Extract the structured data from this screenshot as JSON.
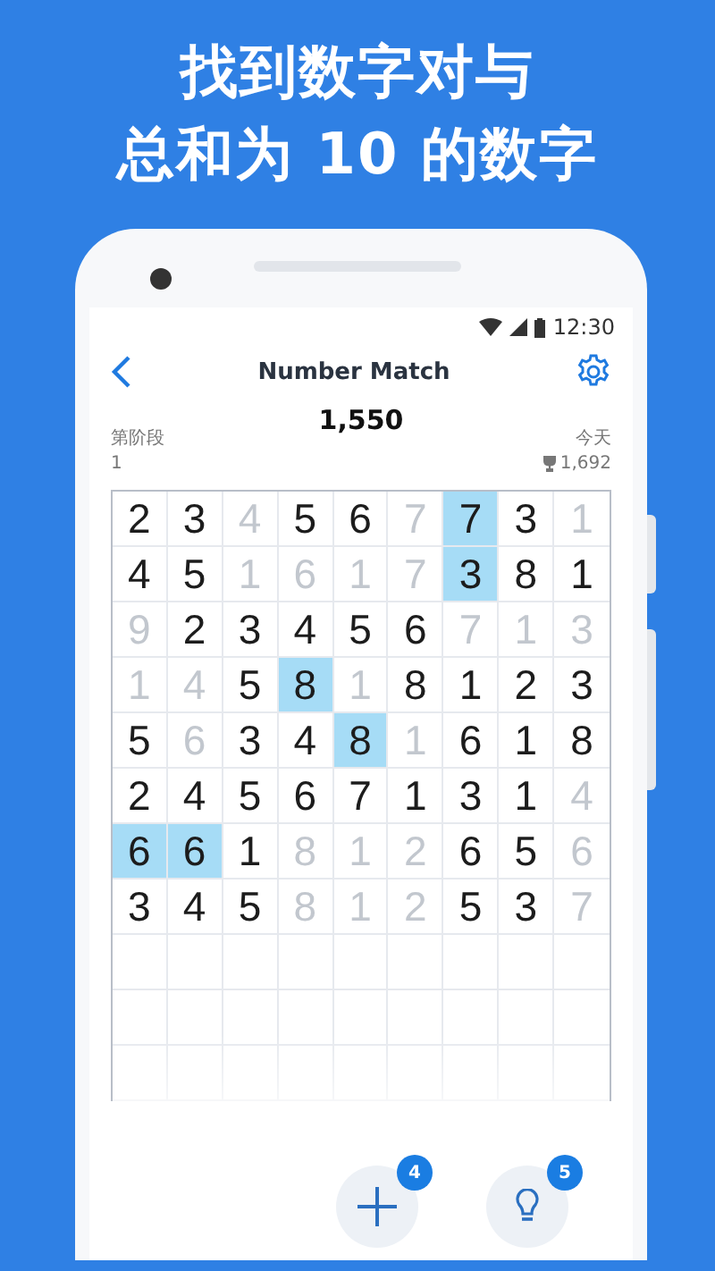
{
  "headline": [
    "找到数字对与",
    "总和为 10 的数字"
  ],
  "status_bar": {
    "time": "12:30"
  },
  "app_bar": {
    "title": "Number Match"
  },
  "score": "1,550",
  "stage": {
    "label": "第阶段",
    "value": "1"
  },
  "best": {
    "label": "今天",
    "value": "1,692"
  },
  "grid": [
    [
      {
        "digit": "2",
        "faded": false,
        "selected": false
      },
      {
        "digit": "3",
        "faded": false,
        "selected": false
      },
      {
        "digit": "4",
        "faded": true,
        "selected": false
      },
      {
        "digit": "5",
        "faded": false,
        "selected": false
      },
      {
        "digit": "6",
        "faded": false,
        "selected": false
      },
      {
        "digit": "7",
        "faded": true,
        "selected": false
      },
      {
        "digit": "7",
        "faded": false,
        "selected": true
      },
      {
        "digit": "3",
        "faded": false,
        "selected": false
      },
      {
        "digit": "1",
        "faded": true,
        "selected": false
      }
    ],
    [
      {
        "digit": "4",
        "faded": false,
        "selected": false
      },
      {
        "digit": "5",
        "faded": false,
        "selected": false
      },
      {
        "digit": "1",
        "faded": true,
        "selected": false
      },
      {
        "digit": "6",
        "faded": true,
        "selected": false
      },
      {
        "digit": "1",
        "faded": true,
        "selected": false
      },
      {
        "digit": "7",
        "faded": true,
        "selected": false
      },
      {
        "digit": "3",
        "faded": false,
        "selected": true
      },
      {
        "digit": "8",
        "faded": false,
        "selected": false
      },
      {
        "digit": "1",
        "faded": false,
        "selected": false
      }
    ],
    [
      {
        "digit": "9",
        "faded": true,
        "selected": false
      },
      {
        "digit": "2",
        "faded": false,
        "selected": false
      },
      {
        "digit": "3",
        "faded": false,
        "selected": false
      },
      {
        "digit": "4",
        "faded": false,
        "selected": false
      },
      {
        "digit": "5",
        "faded": false,
        "selected": false
      },
      {
        "digit": "6",
        "faded": false,
        "selected": false
      },
      {
        "digit": "7",
        "faded": true,
        "selected": false
      },
      {
        "digit": "1",
        "faded": true,
        "selected": false
      },
      {
        "digit": "3",
        "faded": true,
        "selected": false
      }
    ],
    [
      {
        "digit": "1",
        "faded": true,
        "selected": false
      },
      {
        "digit": "4",
        "faded": true,
        "selected": false
      },
      {
        "digit": "5",
        "faded": false,
        "selected": false
      },
      {
        "digit": "8",
        "faded": false,
        "selected": true
      },
      {
        "digit": "1",
        "faded": true,
        "selected": false
      },
      {
        "digit": "8",
        "faded": false,
        "selected": false
      },
      {
        "digit": "1",
        "faded": false,
        "selected": false
      },
      {
        "digit": "2",
        "faded": false,
        "selected": false
      },
      {
        "digit": "3",
        "faded": false,
        "selected": false
      }
    ],
    [
      {
        "digit": "5",
        "faded": false,
        "selected": false
      },
      {
        "digit": "6",
        "faded": true,
        "selected": false
      },
      {
        "digit": "3",
        "faded": false,
        "selected": false
      },
      {
        "digit": "4",
        "faded": false,
        "selected": false
      },
      {
        "digit": "8",
        "faded": false,
        "selected": true
      },
      {
        "digit": "1",
        "faded": true,
        "selected": false
      },
      {
        "digit": "6",
        "faded": false,
        "selected": false
      },
      {
        "digit": "1",
        "faded": false,
        "selected": false
      },
      {
        "digit": "8",
        "faded": false,
        "selected": false
      }
    ],
    [
      {
        "digit": "2",
        "faded": false,
        "selected": false
      },
      {
        "digit": "4",
        "faded": false,
        "selected": false
      },
      {
        "digit": "5",
        "faded": false,
        "selected": false
      },
      {
        "digit": "6",
        "faded": false,
        "selected": false
      },
      {
        "digit": "7",
        "faded": false,
        "selected": false
      },
      {
        "digit": "1",
        "faded": false,
        "selected": false
      },
      {
        "digit": "3",
        "faded": false,
        "selected": false
      },
      {
        "digit": "1",
        "faded": false,
        "selected": false
      },
      {
        "digit": "4",
        "faded": true,
        "selected": false
      }
    ],
    [
      {
        "digit": "6",
        "faded": false,
        "selected": true
      },
      {
        "digit": "6",
        "faded": false,
        "selected": true
      },
      {
        "digit": "1",
        "faded": false,
        "selected": false
      },
      {
        "digit": "8",
        "faded": true,
        "selected": false
      },
      {
        "digit": "1",
        "faded": true,
        "selected": false
      },
      {
        "digit": "2",
        "faded": true,
        "selected": false
      },
      {
        "digit": "6",
        "faded": false,
        "selected": false
      },
      {
        "digit": "5",
        "faded": false,
        "selected": false
      },
      {
        "digit": "6",
        "faded": true,
        "selected": false
      }
    ],
    [
      {
        "digit": "3",
        "faded": false,
        "selected": false
      },
      {
        "digit": "4",
        "faded": false,
        "selected": false
      },
      {
        "digit": "5",
        "faded": false,
        "selected": false
      },
      {
        "digit": "8",
        "faded": true,
        "selected": false
      },
      {
        "digit": "1",
        "faded": true,
        "selected": false
      },
      {
        "digit": "2",
        "faded": true,
        "selected": false
      },
      {
        "digit": "5",
        "faded": false,
        "selected": false
      },
      {
        "digit": "3",
        "faded": false,
        "selected": false
      },
      {
        "digit": "7",
        "faded": true,
        "selected": false
      }
    ]
  ],
  "actions": [
    {
      "kind": "add",
      "badge": "4"
    },
    {
      "kind": "hint",
      "badge": "5"
    }
  ]
}
